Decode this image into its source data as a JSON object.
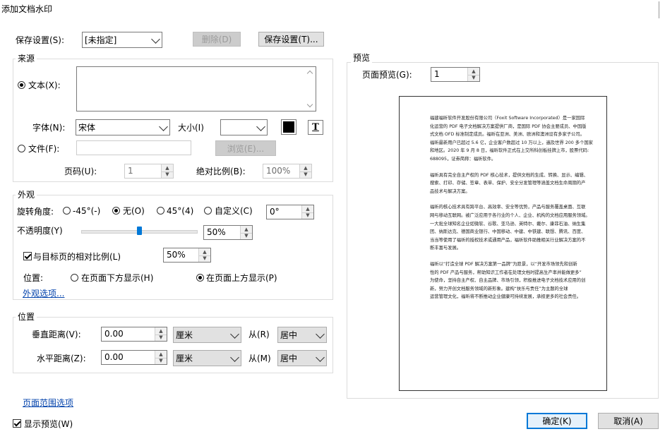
{
  "window": {
    "title": "添加文档水印"
  },
  "top": {
    "save_settings_label": "保存设置(S):",
    "save_settings_value": "[未指定]",
    "delete_button": "删除(D)",
    "save_settings_button": "保存设置(T)..."
  },
  "source": {
    "group_title": "来源",
    "text_radio": "文本(X):",
    "font_label": "字体(N):",
    "font_value": "宋体",
    "size_label": "大小(I)",
    "size_value": "",
    "file_radio": "文件(F):",
    "browse_button": "浏览(E)...",
    "page_label": "页码(U):",
    "page_value": "1",
    "scale_label": "绝对比例(B):",
    "scale_value": "100%",
    "text_color": "#000000"
  },
  "appearance": {
    "group_title": "外观",
    "rotation_label": "旋转角度:",
    "rot_m45": "-45°(-)",
    "rot_none": "无(O)",
    "rot_45": "45°(4)",
    "rot_custom": "自定义(C)",
    "rot_custom_value": "0°",
    "opacity_label": "不透明度(Y)",
    "opacity_value": "50%",
    "opacity_level": 0.5,
    "relative_scale_label": "与目标页的相对比例(L)",
    "relative_scale_value": "50%",
    "position_label": "位置:",
    "pos_below": "在页面下方显示(H)",
    "pos_above": "在页面上方显示(P)",
    "more_link": "外观选项..."
  },
  "position": {
    "group_title": "位置",
    "vertical_label": "垂直距离(V):",
    "vertical_value": "0.00",
    "vertical_unit": "厘米",
    "vertical_from_label": "从(R)",
    "vertical_from": "居中",
    "horizontal_label": "水平距离(Z):",
    "horizontal_value": "0.00",
    "horizontal_unit": "厘米",
    "horizontal_from_label": "从(M)",
    "horizontal_from": "居中"
  },
  "page_range_link": "页面范围选项",
  "show_preview": "显示预览(W)",
  "preview": {
    "group_title": "预览",
    "page_label": "页面预览(G):",
    "page_value": "1",
    "paragraphs": [
      [
        "福建福昕软件开发股份有限公司（Foxit Software Incorporated）是一家国际",
        "化运营的 PDF 电子文档解决方案提供厂商，是国际 PDF 协会主要成员、中国版",
        "式文档 OFD 标准制定成员。福昕在亚洲、美洲、欧洲和澳洲设有多家子公司。",
        "福昕最新用户已超过 5.6 亿，企业客户数超过 10 万以上，遍及世界 200 多个国家",
        "和地区。2020 年 9 月 8 日，福昕软件正式在上交所科创板挂牌上市，股票代码:",
        "688095，证券简称：福昕软件。"
      ],
      [
        "福昕具有完全自主产权的 PDF 核心技术，提供文档的生成、转换、显示、编辑、",
        "搜索、打印、存储、签章、表单、保护、安全分发管理等涵盖文档生命周期的产",
        "品技术与解决方案。"
      ],
      [
        "福昕的核心技术具有跨平台、高效率、安全等优势，产品与服务覆盖桌面、互联",
        "网与移动互联网。被广泛应用于各行业的个人、企业、机构的文档应用服务领域。",
        "一大批全球知名企业如微软、谷歌、亚马逊、英特尔、戴尔、康菲石油、纳生集",
        "团、纳斯达克、德国商业银行、中国移动、中建、中铁建、联想、腾讯、百度、",
        "当当等使用了福昕的授权技术或通用产品，福昕软件助推相关行业解决方案的不",
        "断丰富与发展。"
      ],
      [
        "福昕以“打造全球 PDF 解决方案第一品牌”为愿景，以“开发市场领先和创新",
        "性的 PDF 产品与服务，帮助知识工作者在处理文档时提高生产率并能做更多”",
        "为使命，坚持自主产权、自主品牌、市场引领，积极推进电子文档技术应用的创",
        "新，努力开创文档服务领域的新形象。建构“扶乐与责任”为主题的全球",
        "运营管理文化，福昕将不断推动企业健康可持续发展，承担更多的社会责任。"
      ]
    ]
  },
  "buttons": {
    "ok": "确定(K)",
    "cancel": "取消(A)"
  },
  "colors": {
    "accent": "#0078d7",
    "link": "#0645ad"
  }
}
